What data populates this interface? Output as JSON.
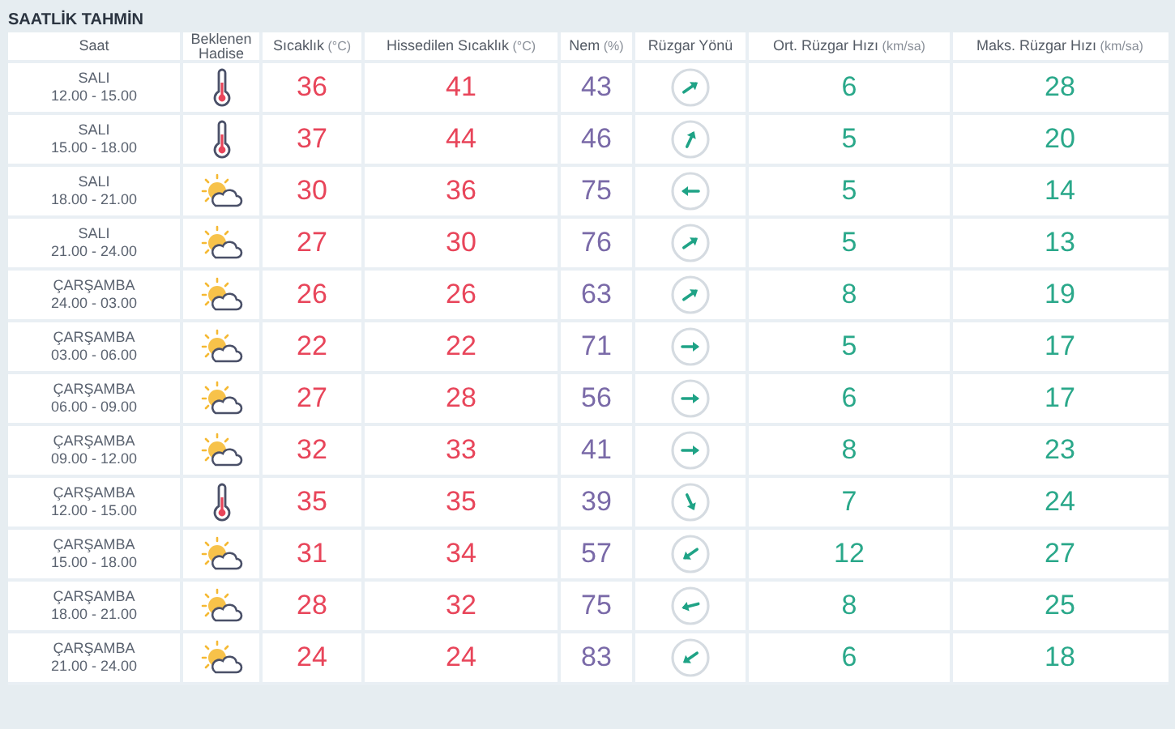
{
  "title": "SAATLİK TAHMİN",
  "columns": [
    {
      "label": "Saat"
    },
    {
      "label": "Beklenen Hadise"
    },
    {
      "label": "Sıcaklık",
      "unit": "(°C)"
    },
    {
      "label": "Hissedilen Sıcaklık",
      "unit": "(°C)"
    },
    {
      "label": "Nem",
      "unit": "(%)"
    },
    {
      "label": "Rüzgar Yönü"
    },
    {
      "label": "Ort. Rüzgar Hızı",
      "unit": "(km/sa)"
    },
    {
      "label": "Maks. Rüzgar Hızı",
      "unit": "(km/sa)"
    }
  ],
  "rows": [
    {
      "day": "SALI",
      "time": "12.00 - 15.00",
      "weather": {
        "kind": "hot"
      },
      "temp": "36",
      "feels": "41",
      "humidity": "43",
      "wind_arrow": {
        "kind": "ne"
      },
      "wind_avg": "6",
      "wind_max": "28"
    },
    {
      "day": "SALI",
      "time": "15.00 - 18.00",
      "weather": {
        "kind": "hot"
      },
      "temp": "37",
      "feels": "44",
      "humidity": "46",
      "wind_arrow": {
        "kind": "nne"
      },
      "wind_avg": "5",
      "wind_max": "20"
    },
    {
      "day": "SALI",
      "time": "18.00 - 21.00",
      "weather": {
        "kind": "cloudy"
      },
      "temp": "30",
      "feels": "36",
      "humidity": "75",
      "wind_arrow": {
        "kind": "w"
      },
      "wind_avg": "5",
      "wind_max": "14"
    },
    {
      "day": "SALI",
      "time": "21.00 - 24.00",
      "weather": {
        "kind": "cloudy"
      },
      "temp": "27",
      "feels": "30",
      "humidity": "76",
      "wind_arrow": {
        "kind": "ne"
      },
      "wind_avg": "5",
      "wind_max": "13"
    },
    {
      "day": "ÇARŞAMBA",
      "time": "24.00 - 03.00",
      "weather": {
        "kind": "cloudy"
      },
      "temp": "26",
      "feels": "26",
      "humidity": "63",
      "wind_arrow": {
        "kind": "ne"
      },
      "wind_avg": "8",
      "wind_max": "19"
    },
    {
      "day": "ÇARŞAMBA",
      "time": "03.00 - 06.00",
      "weather": {
        "kind": "cloudy"
      },
      "temp": "22",
      "feels": "22",
      "humidity": "71",
      "wind_arrow": {
        "kind": "e"
      },
      "wind_avg": "5",
      "wind_max": "17"
    },
    {
      "day": "ÇARŞAMBA",
      "time": "06.00 - 09.00",
      "weather": {
        "kind": "cloudy"
      },
      "temp": "27",
      "feels": "28",
      "humidity": "56",
      "wind_arrow": {
        "kind": "e"
      },
      "wind_avg": "6",
      "wind_max": "17"
    },
    {
      "day": "ÇARŞAMBA",
      "time": "09.00 - 12.00",
      "weather": {
        "kind": "cloudy"
      },
      "temp": "32",
      "feels": "33",
      "humidity": "41",
      "wind_arrow": {
        "kind": "e"
      },
      "wind_avg": "8",
      "wind_max": "23"
    },
    {
      "day": "ÇARŞAMBA",
      "time": "12.00 - 15.00",
      "weather": {
        "kind": "hot"
      },
      "temp": "35",
      "feels": "35",
      "humidity": "39",
      "wind_arrow": {
        "kind": "sse"
      },
      "wind_avg": "7",
      "wind_max": "24"
    },
    {
      "day": "ÇARŞAMBA",
      "time": "15.00 - 18.00",
      "weather": {
        "kind": "cloudy"
      },
      "temp": "31",
      "feels": "34",
      "humidity": "57",
      "wind_arrow": {
        "kind": "sw"
      },
      "wind_avg": "12",
      "wind_max": "27"
    },
    {
      "day": "ÇARŞAMBA",
      "time": "18.00 - 21.00",
      "weather": {
        "kind": "cloudy"
      },
      "temp": "28",
      "feels": "32",
      "humidity": "75",
      "wind_arrow": {
        "kind": "wsw"
      },
      "wind_avg": "8",
      "wind_max": "25"
    },
    {
      "day": "ÇARŞAMBA",
      "time": "21.00 - 24.00",
      "weather": {
        "kind": "cloudy"
      },
      "temp": "24",
      "feels": "24",
      "humidity": "83",
      "wind_arrow": {
        "kind": "sw"
      },
      "wind_avg": "6",
      "wind_max": "18"
    }
  ]
}
